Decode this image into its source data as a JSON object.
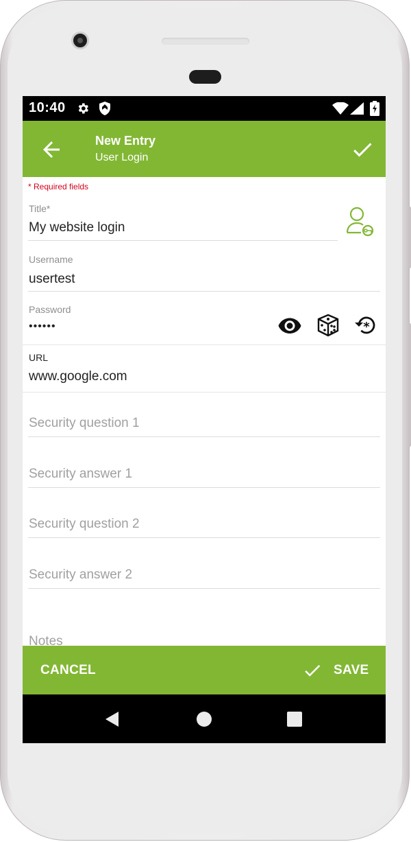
{
  "status_bar": {
    "time": "10:40",
    "icons": [
      "gear-icon",
      "shield-icon",
      "wifi-icon",
      "signal-icon",
      "battery-icon"
    ]
  },
  "app_bar": {
    "title": "New Entry",
    "subtitle": "User Login",
    "back_icon": "arrow-left-icon",
    "confirm_icon": "check-icon"
  },
  "form": {
    "required_note": "* Required fields",
    "title": {
      "label": "Title*",
      "value": "My website login",
      "icon": "user-key-icon"
    },
    "username": {
      "label": "Username",
      "value": "usertest"
    },
    "password": {
      "label": "Password",
      "value": "••••••",
      "icons": [
        "eye-icon",
        "dice-icon",
        "password-history-icon"
      ]
    },
    "url": {
      "label": "URL",
      "value": "www.google.com"
    },
    "security_question_1": {
      "placeholder": "Security question 1"
    },
    "security_answer_1": {
      "placeholder": "Security answer 1"
    },
    "security_question_2": {
      "placeholder": "Security question 2"
    },
    "security_answer_2": {
      "placeholder": "Security answer 2"
    },
    "notes": {
      "placeholder": "Notes"
    }
  },
  "bottom_bar": {
    "cancel_label": "CANCEL",
    "save_label": "SAVE"
  },
  "nav_bar": {
    "icons": [
      "back-triangle-icon",
      "home-circle-icon",
      "recents-square-icon"
    ]
  },
  "colors": {
    "accent": "#82b734",
    "required": "#d0021b",
    "status_bar": "#000000"
  }
}
